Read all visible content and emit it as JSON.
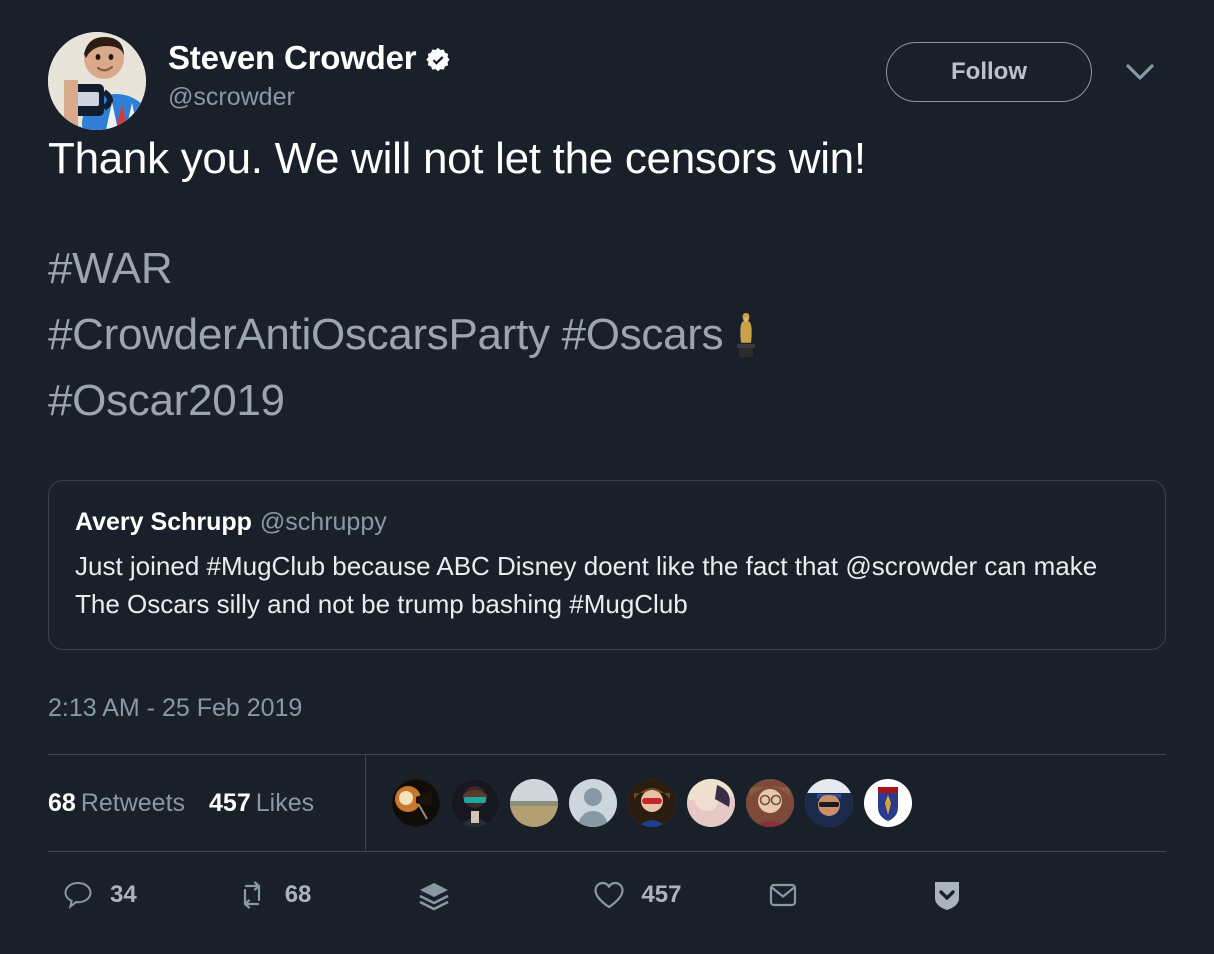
{
  "author": {
    "display_name": "Steven Crowder",
    "handle": "@scrowder",
    "verified": true,
    "avatar_alt": "man-with-mug-avatar"
  },
  "header": {
    "follow_label": "Follow",
    "caret_icon": "chevron-down-icon"
  },
  "tweet": {
    "text": "Thank you. We will not let the censors win!",
    "hashtag_line_1": "#WAR",
    "hashtag_line_2": "#CrowderAntiOscarsParty #Oscars",
    "emoji": "oscar-statuette-emoji",
    "hashtag_line_3": "#Oscar2019",
    "timestamp": "2:13 AM - 25 Feb 2019"
  },
  "quoted_tweet": {
    "name": "Avery Schrupp",
    "handle": "@schruppy",
    "body": "Just joined #MugClub because ABC Disney doent like the fact that @scrowder can make The Oscars silly and not be trump bashing #MugClub"
  },
  "stats": {
    "retweets_count": "68",
    "retweets_label": "Retweets",
    "likes_count": "457",
    "likes_label": "Likes"
  },
  "likers": [
    {
      "name": "liker-avatar-trumpet-player"
    },
    {
      "name": "liker-avatar-sunglasses-person"
    },
    {
      "name": "liker-avatar-landscape"
    },
    {
      "name": "liker-avatar-default-placeholder"
    },
    {
      "name": "liker-avatar-red-glasses"
    },
    {
      "name": "liker-avatar-blonde-person"
    },
    {
      "name": "liker-avatar-glasses-woman"
    },
    {
      "name": "liker-avatar-cap-person"
    },
    {
      "name": "liker-avatar-berlin-emblem"
    }
  ],
  "actions": {
    "reply_count": "34",
    "retweet_count": "68",
    "like_count": "457",
    "reply_icon": "comment-icon",
    "retweet_icon": "retweet-icon",
    "stack_icon": "layers-icon",
    "like_icon": "heart-icon",
    "dm_icon": "envelope-icon",
    "more_icon": "shield-chevron-down-icon"
  },
  "colors": {
    "background": "#1a2029",
    "text_primary": "#ffffff",
    "text_muted": "#8899a6",
    "divider": "#394753",
    "card_border": "#38444d"
  }
}
